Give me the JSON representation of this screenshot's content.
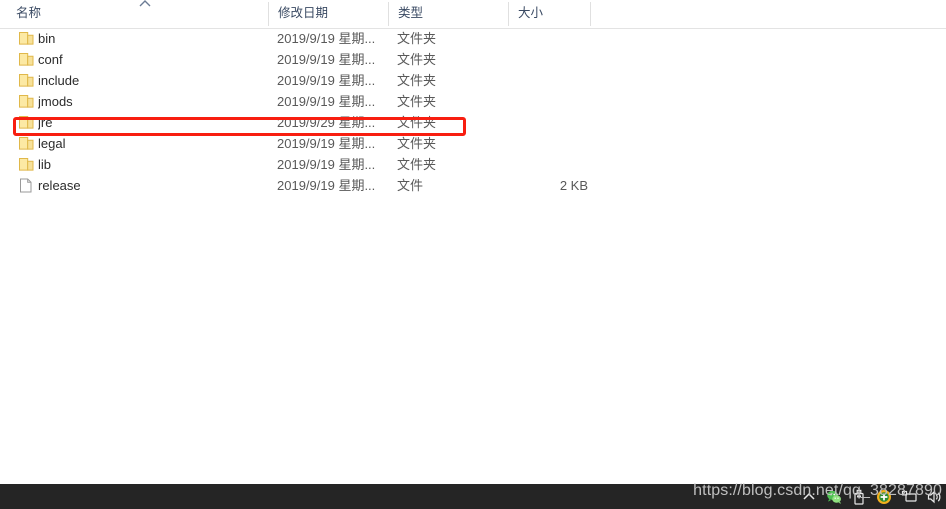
{
  "window": {
    "app": "file-explorer"
  },
  "columns": [
    {
      "key": "name",
      "label": "名称",
      "sorted": "asc"
    },
    {
      "key": "date",
      "label": "修改日期",
      "sorted": ""
    },
    {
      "key": "type",
      "label": "类型",
      "sorted": ""
    },
    {
      "key": "size",
      "label": "大小",
      "sorted": ""
    }
  ],
  "files": [
    {
      "name": "bin",
      "date": "2019/9/19 星期...",
      "type": "文件夹",
      "size": "",
      "icon": "folder-icon",
      "highlighted": false
    },
    {
      "name": "conf",
      "date": "2019/9/19 星期...",
      "type": "文件夹",
      "size": "",
      "icon": "folder-icon",
      "highlighted": false
    },
    {
      "name": "include",
      "date": "2019/9/19 星期...",
      "type": "文件夹",
      "size": "",
      "icon": "folder-icon",
      "highlighted": false
    },
    {
      "name": "jmods",
      "date": "2019/9/19 星期...",
      "type": "文件夹",
      "size": "",
      "icon": "folder-icon",
      "highlighted": false
    },
    {
      "name": "jre",
      "date": "2019/9/29 星期...",
      "type": "文件夹",
      "size": "",
      "icon": "folder-icon",
      "highlighted": true
    },
    {
      "name": "legal",
      "date": "2019/9/19 星期...",
      "type": "文件夹",
      "size": "",
      "icon": "folder-icon",
      "highlighted": false
    },
    {
      "name": "lib",
      "date": "2019/9/19 星期...",
      "type": "文件夹",
      "size": "",
      "icon": "folder-icon",
      "highlighted": false
    },
    {
      "name": "release",
      "date": "2019/9/19 星期...",
      "type": "文件",
      "size": "2 KB",
      "icon": "document-icon",
      "highlighted": false
    }
  ],
  "annotation": {
    "target": "jre",
    "shape": "rectangle",
    "color": "#f81e10"
  },
  "watermark": {
    "text": "https://blog.csdn.net/qq_38287890"
  },
  "taskbar": {
    "background": "#252525",
    "tray_icons": [
      "show-hidden-icons-chevron-icon",
      "wechat-icon",
      "usb-drive-icon",
      "update-shield-icon",
      "network-icon",
      "volume-icon"
    ]
  },
  "colors": {
    "header_text": "#3a4a63",
    "row_text": "#2b2b2b",
    "secondary_text": "#595959",
    "folder_fill": "#fce9a4",
    "folder_stroke": "#e0b84a",
    "divider": "#e0e0e0",
    "accent_red": "#f81e10",
    "watermark": "#bfbfbf"
  }
}
